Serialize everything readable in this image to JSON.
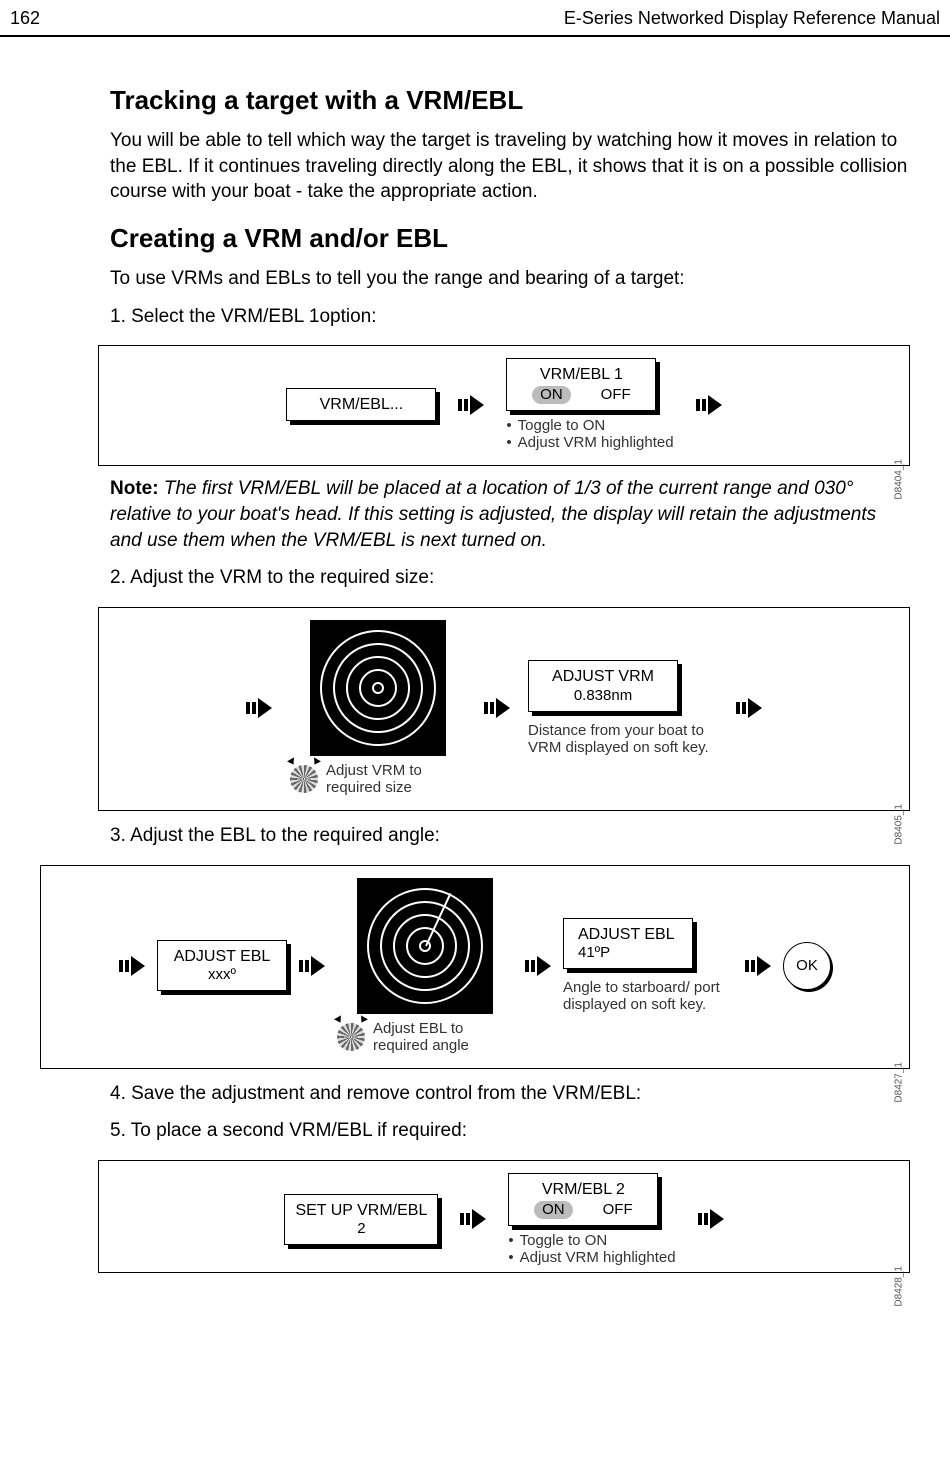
{
  "header": {
    "page_no": "162",
    "title": "E-Series Networked Display Reference Manual"
  },
  "h2a": "Tracking a target with a VRM/EBL",
  "p1": "You will be able to tell which way the target is traveling by watching how it moves in relation to the EBL. If it continues traveling directly along the EBL, it shows that it is on a possible collision course with your boat - take the appropriate action.",
  "h2b": "Creating a VRM and/or EBL",
  "p2": "To use VRMs and EBLs to tell you the range and bearing of a target:",
  "step1": "1.   Select the VRM/EBL 1option:",
  "panel1": {
    "btn1": "VRM/EBL...",
    "btn2_top": "VRM/EBL 1",
    "on": "ON",
    "off": "OFF",
    "note1": "Toggle to ON",
    "note2": "Adjust VRM highlighted",
    "code": "D8404_1"
  },
  "note_label": "Note:",
  "note_body": " The first VRM/EBL will be placed at a location of 1/3 of the current range and 030° relative to your boat's head. If this setting is adjusted, the display will retain the adjustments and use them when the VRM/EBL is next turned on.",
  "step2": "2.   Adjust the VRM to the required size:",
  "panel2": {
    "knob_label": "Adjust VRM to required size",
    "btn_top": "ADJUST VRM",
    "btn_sub": "0.838nm",
    "caption": "Distance from your boat to VRM displayed on soft key.",
    "code": "D8405_1"
  },
  "step3": "3.   Adjust the EBL to the required angle:",
  "panel3": {
    "btn1_top": "ADJUST EBL",
    "btn1_sub": "xxxº",
    "knob_label": "Adjust EBL to required angle",
    "btn2_top": "ADJUST EBL",
    "btn2_sub": "41ºP",
    "caption": "Angle to starboard/ port displayed on soft key.",
    "ok": "OK",
    "code": "D8427_1"
  },
  "step4": "4.   Save the adjustment and remove control from the VRM/EBL:",
  "step5": "5.   To place a second VRM/EBL if required:",
  "panel4": {
    "btn1_top": "SET UP VRM/EBL",
    "btn1_sub": "2",
    "btn2_top": "VRM/EBL 2",
    "on": "ON",
    "off": "OFF",
    "note1": "Toggle to ON",
    "note2": "Adjust VRM highlighted",
    "code": "D8428_1"
  }
}
